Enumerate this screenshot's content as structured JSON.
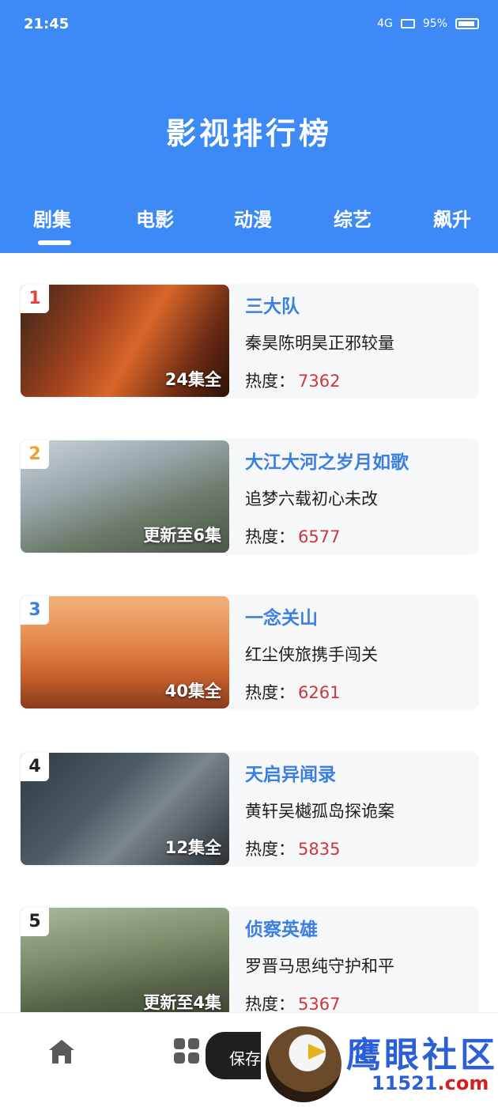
{
  "status_bar": {
    "time": "21:45",
    "network": "4G",
    "battery": "95%"
  },
  "header": {
    "title": "影视排行榜"
  },
  "tabs": [
    {
      "label": "剧集",
      "active": true
    },
    {
      "label": "电影",
      "active": false
    },
    {
      "label": "动漫",
      "active": false
    },
    {
      "label": "综艺",
      "active": false
    },
    {
      "label": "飙升",
      "active": false
    }
  ],
  "list": [
    {
      "rank": "1",
      "rank_color": "#e0483b",
      "title": "三大队",
      "subtitle": "秦昊陈明昊正邪较量",
      "heat_label": "热度：",
      "heat": "7362",
      "episode": "24集全"
    },
    {
      "rank": "2",
      "rank_color": "#f0a030",
      "title": "大江大河之岁月如歌",
      "subtitle": "追梦六载初心未改",
      "heat_label": "热度：",
      "heat": "6577",
      "episode": "更新至6集"
    },
    {
      "rank": "3",
      "rank_color": "#3c7fe0",
      "title": "一念关山",
      "subtitle": "红尘侠旅携手闯关",
      "heat_label": "热度：",
      "heat": "6261",
      "episode": "40集全"
    },
    {
      "rank": "4",
      "rank_color": "#222222",
      "title": "天启异闻录",
      "subtitle": "黄轩吴樾孤岛探诡案",
      "heat_label": "热度：",
      "heat": "5835",
      "episode": "12集全"
    },
    {
      "rank": "5",
      "rank_color": "#222222",
      "title": "侦察英雄",
      "subtitle": "罗晋马思纯守护和平",
      "heat_label": "热度：",
      "heat": "5367",
      "episode": "更新至4集"
    }
  ],
  "toast": {
    "text": "保存"
  },
  "watermark": {
    "name": "鹰眼社区",
    "url_num": "11521",
    "url_suffix": ".com"
  },
  "colors": {
    "header_bg": "#3d8af7",
    "title_blue": "#3c7fe0",
    "heat_red": "#c8383d"
  }
}
